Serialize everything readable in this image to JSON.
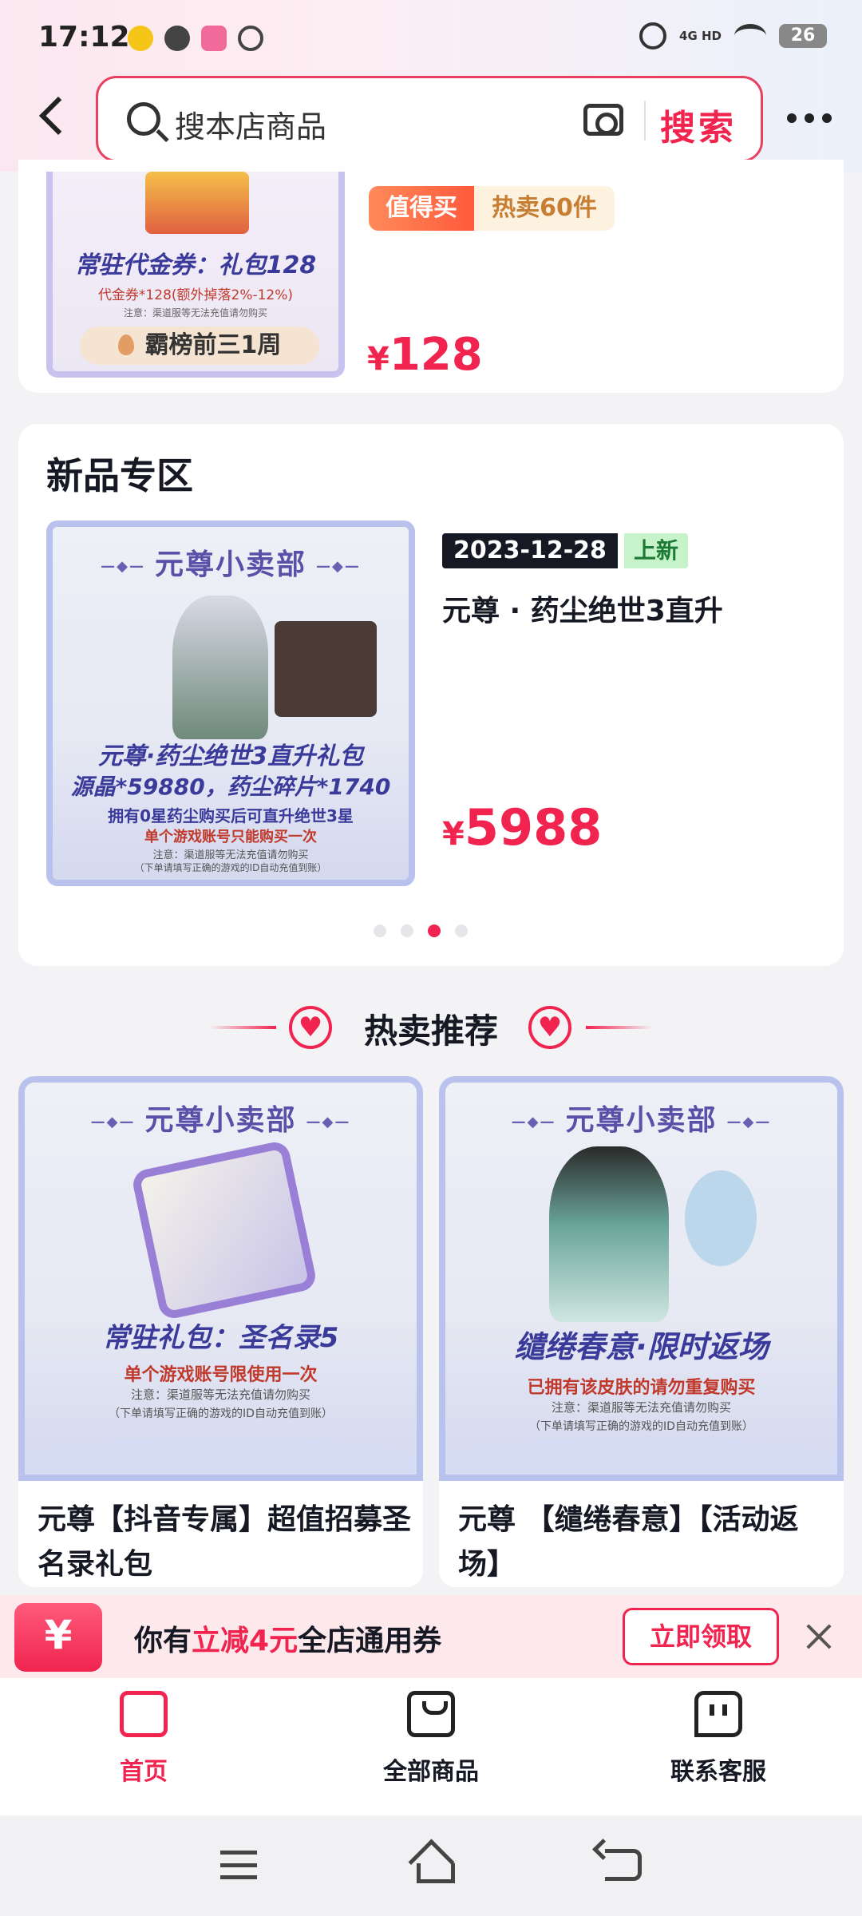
{
  "status_bar": {
    "time": "17:12",
    "network": "4G HD",
    "battery": "26"
  },
  "header": {
    "search_placeholder": "搜本店商品",
    "search_button": "搜索"
  },
  "top_product": {
    "image_title": "常驻代金券：礼包128",
    "image_subtitle": "代金券*128(额外掉落2%-12%)",
    "image_note": "注意：渠道服等无法充值请勿购买",
    "image_pill": "霸榜前三1周",
    "tag_worth": "值得买",
    "tag_hot": "热卖60件",
    "currency": "¥",
    "price": "128"
  },
  "new_section": {
    "title": "新品专区",
    "product": {
      "image_banner": "元尊小卖部",
      "image_line1": "元尊·药尘绝世3直升礼包",
      "image_line2": "源晶*59880，药尘碎片*1740",
      "image_line3": "拥有0星药尘购买后可直升绝世3星",
      "image_line4": "单个游戏账号只能购买一次",
      "image_note1": "注意：渠道服等无法充值请勿购买",
      "image_note2": "（下单请填写正确的游戏的ID自动充值到账）",
      "date": "2023-12-28",
      "new_label": "上新",
      "name": "元尊 · 药尘绝世3直升",
      "currency": "¥",
      "price": "5988"
    },
    "carousel_pages": 4,
    "carousel_active": 3
  },
  "hot_section": {
    "title": "热卖推荐",
    "items": [
      {
        "image_banner": "元尊小卖部",
        "image_line1": "常驻礼包：圣名录5",
        "image_line2": "单个游戏账号限使用一次",
        "image_note1": "注意：渠道服等无法充值请勿购买",
        "image_note2": "（下单请填写正确的游戏的ID自动充值到账）",
        "name": "元尊【抖音专属】超值招募圣名录礼包"
      },
      {
        "image_banner": "元尊小卖部",
        "image_line1": "缱绻春意·限时返场",
        "image_line2": "已拥有该皮肤的请勿重复购买",
        "image_note1": "注意：渠道服等无法充值请勿购买",
        "image_note2": "（下单请填写正确的游戏的ID自动充值到账）",
        "name": "元尊 【缱绻春意】【活动返场】"
      }
    ]
  },
  "coupon": {
    "icon_symbol": "¥",
    "text_prefix": "你有",
    "text_highlight": "立减4元",
    "text_suffix": "全店通用券",
    "button": "立即领取"
  },
  "tabs": [
    {
      "label": "首页",
      "active": true
    },
    {
      "label": "全部商品",
      "active": false
    },
    {
      "label": "联系客服",
      "active": false
    }
  ],
  "colors": {
    "accent": "#f0244f",
    "text": "#161823",
    "card_border": "#b9c2ec"
  }
}
